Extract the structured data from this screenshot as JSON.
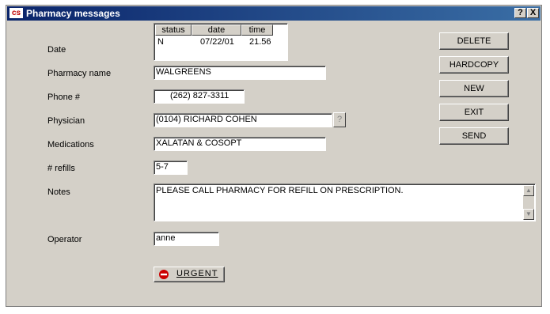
{
  "window": {
    "title": "Pharmacy messages",
    "app_icon": "cs",
    "help_button": "?",
    "close_button": "X"
  },
  "labels": {
    "date": "Date",
    "pharmacy_name": "Pharmacy name",
    "phone": "Phone #",
    "physician": "Physician",
    "medications": "Medications",
    "refills": "# refills",
    "notes": "Notes",
    "operator": "Operator"
  },
  "status_grid": {
    "headers": [
      "status",
      "date",
      "time"
    ],
    "rows": [
      [
        "N",
        "07/22/01",
        "21.56"
      ]
    ]
  },
  "fields": {
    "pharmacy_name": "WALGREENS",
    "phone": "(262) 827-3311",
    "physician": "(0104) RICHARD COHEN",
    "physician_lookup": "?",
    "medications": "XALATAN & COSOPT",
    "refills": "5-7",
    "notes": "PLEASE CALL PHARMACY FOR REFILL ON PRESCRIPTION.",
    "operator": "anne"
  },
  "buttons": {
    "delete": "DELETE",
    "hardcopy": "HARDCOPY",
    "new": "NEW",
    "exit": "EXIT",
    "send": "SEND",
    "urgent": "URGENT"
  },
  "icons": {
    "urgent": "no-entry-icon",
    "scroll_up": "up-arrow-icon",
    "scroll_down": "down-arrow-icon"
  },
  "colors": {
    "titlebar_start": "#0a246a",
    "titlebar_end": "#3a6ea5",
    "dialog_bg": "#d4d0c8",
    "urgent_icon": "#cc0000"
  }
}
